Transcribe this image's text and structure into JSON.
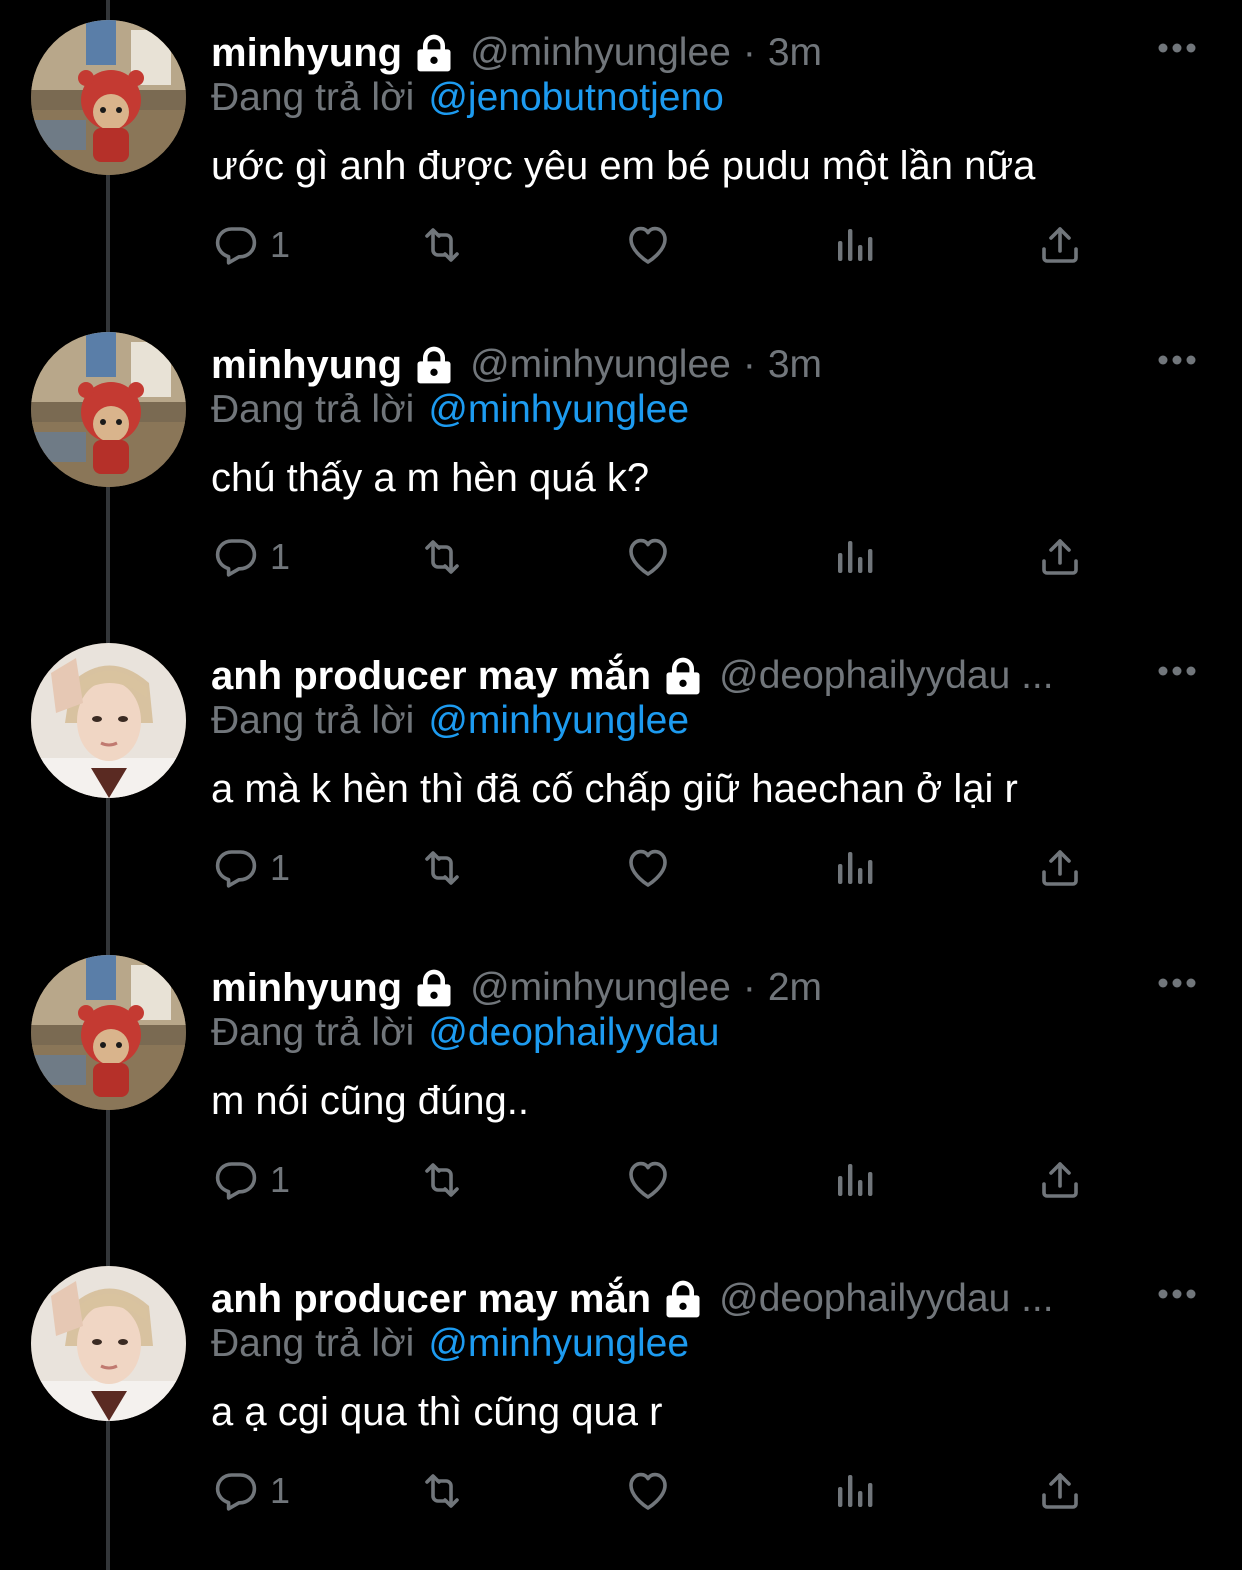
{
  "colors": {
    "background": "#000000",
    "primary_text": "#ffffff",
    "secondary_text": "#71767b",
    "link": "#1d9bf0",
    "thread_line": "#333639"
  },
  "icons": {
    "protected": "lock-icon",
    "more": "more-dots-icon",
    "reply": "reply-bubble-icon",
    "retweet": "retweet-icon",
    "like": "heart-icon",
    "views": "views-bar-icon",
    "share": "share-icon"
  },
  "tweets": [
    {
      "display_name": "minhyung",
      "handle": "@minhyunglee",
      "separator": "·",
      "time": "3m",
      "reply_prefix": "Đang trả lời",
      "reply_to": "@jenobutnotjeno",
      "text": "ước gì anh được yêu em bé pudu một lần nữa",
      "reply_count": "1",
      "avatar": "bear-avatar"
    },
    {
      "display_name": "minhyung",
      "handle": "@minhyunglee",
      "separator": "·",
      "time": "3m",
      "reply_prefix": "Đang trả lời",
      "reply_to": "@minhyunglee",
      "text": "chú thấy a m hèn quá k?",
      "reply_count": "1",
      "avatar": "bear-avatar"
    },
    {
      "display_name": "anh producer may mắn",
      "handle": "@deophailyydau ...",
      "reply_prefix": "Đang trả lời",
      "reply_to": "@minhyunglee",
      "text": "a mà k hèn thì đã cố chấp giữ haechan ở lại r",
      "reply_count": "1",
      "avatar": "person-avatar"
    },
    {
      "display_name": "minhyung",
      "handle": "@minhyunglee",
      "separator": "·",
      "time": "2m",
      "reply_prefix": "Đang trả lời",
      "reply_to": "@deophailyydau",
      "text": "m nói cũng đúng..",
      "reply_count": "1",
      "avatar": "bear-avatar"
    },
    {
      "display_name": "anh producer may mắn",
      "handle": "@deophailyydau ...",
      "reply_prefix": "Đang trả lời",
      "reply_to": "@minhyunglee",
      "text": "a ạ cgi qua thì cũng qua r",
      "reply_count": "1",
      "avatar": "person-avatar"
    }
  ]
}
